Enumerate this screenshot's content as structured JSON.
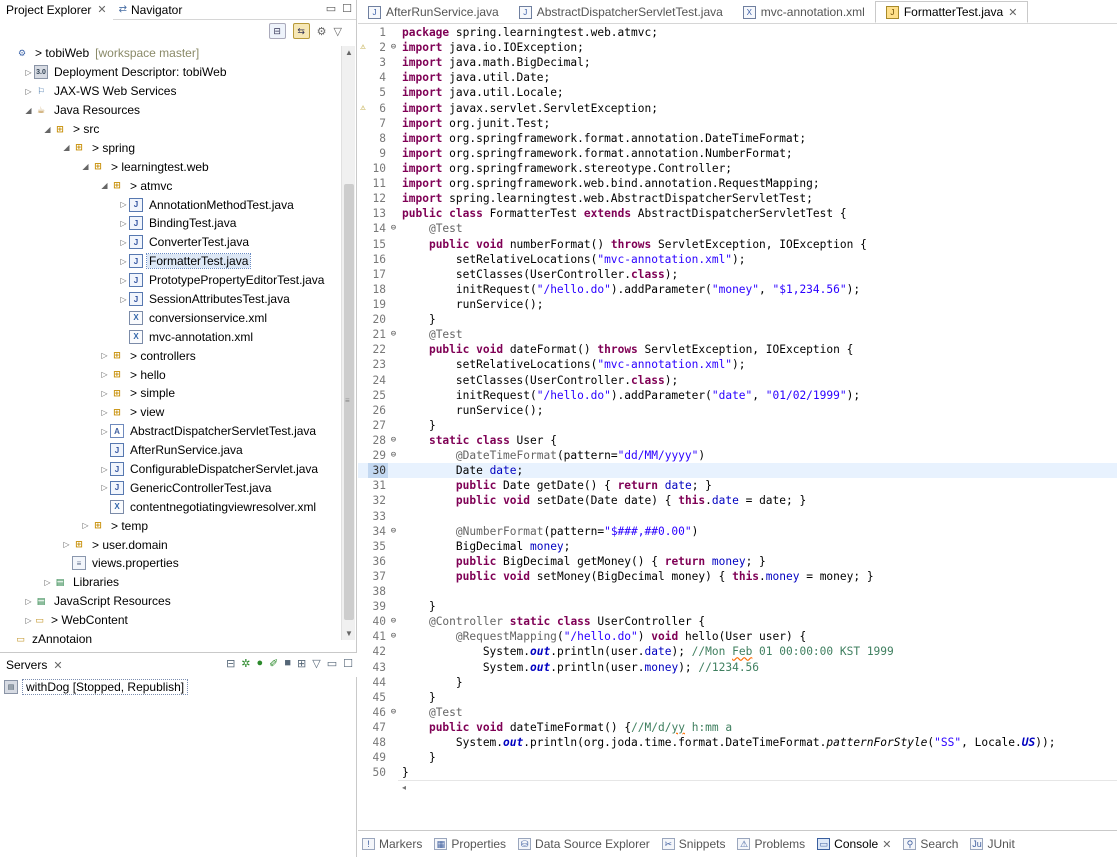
{
  "left_tabs": [
    {
      "label": "Project Explorer",
      "active": true
    },
    {
      "label": "Navigator",
      "active": false
    }
  ],
  "tree": [
    {
      "d": 0,
      "t": "",
      "ic": "proj",
      "g": "⚙",
      "label": "> tobiWeb",
      "extra": "[workspace master]"
    },
    {
      "d": 1,
      "t": "▷",
      "ic": "dd",
      "g": "3.0",
      "label": "Deployment Descriptor: tobiWeb"
    },
    {
      "d": 1,
      "t": "▷",
      "ic": "ws",
      "g": "⚐",
      "label": "JAX-WS Web Services"
    },
    {
      "d": 1,
      "t": "◢",
      "ic": "jres",
      "g": "☕",
      "label": "Java Resources"
    },
    {
      "d": 2,
      "t": "◢",
      "ic": "pkg",
      "g": "⊞",
      "label": "> src"
    },
    {
      "d": 3,
      "t": "◢",
      "ic": "pkg",
      "g": "⊞",
      "label": "> spring"
    },
    {
      "d": 4,
      "t": "◢",
      "ic": "pkg",
      "g": "⊞",
      "label": "> learningtest.web"
    },
    {
      "d": 5,
      "t": "◢",
      "ic": "pkg",
      "g": "⊞",
      "label": "> atmvc"
    },
    {
      "d": 6,
      "t": "▷",
      "ic": "java",
      "g": "J",
      "label": "AnnotationMethodTest.java"
    },
    {
      "d": 6,
      "t": "▷",
      "ic": "java",
      "g": "J",
      "label": "BindingTest.java"
    },
    {
      "d": 6,
      "t": "▷",
      "ic": "java",
      "g": "J",
      "label": "ConverterTest.java"
    },
    {
      "d": 6,
      "t": "▷",
      "ic": "java",
      "g": "J",
      "label": "FormatterTest.java",
      "sel": true
    },
    {
      "d": 6,
      "t": "▷",
      "ic": "java",
      "g": "J",
      "label": "PrototypePropertyEditorTest.java"
    },
    {
      "d": 6,
      "t": "▷",
      "ic": "java",
      "g": "J",
      "label": "SessionAttributesTest.java"
    },
    {
      "d": 6,
      "t": "",
      "ic": "xml",
      "g": "X",
      "label": "conversionservice.xml"
    },
    {
      "d": 6,
      "t": "",
      "ic": "xml",
      "g": "X",
      "label": "mvc-annotation.xml"
    },
    {
      "d": 5,
      "t": "▷",
      "ic": "pkg",
      "g": "⊞",
      "label": "> controllers"
    },
    {
      "d": 5,
      "t": "▷",
      "ic": "pkg",
      "g": "⊞",
      "label": "> hello"
    },
    {
      "d": 5,
      "t": "▷",
      "ic": "pkg",
      "g": "⊞",
      "label": "> simple"
    },
    {
      "d": 5,
      "t": "▷",
      "ic": "pkg",
      "g": "⊞",
      "label": "> view"
    },
    {
      "d": 5,
      "t": "▷",
      "ic": "ann",
      "g": "A",
      "label": "AbstractDispatcherServletTest.java"
    },
    {
      "d": 5,
      "t": "",
      "ic": "java",
      "g": "J",
      "label": "AfterRunService.java"
    },
    {
      "d": 5,
      "t": "▷",
      "ic": "java",
      "g": "J",
      "label": "ConfigurableDispatcherServlet.java"
    },
    {
      "d": 5,
      "t": "▷",
      "ic": "java",
      "g": "J",
      "label": "GenericControllerTest.java"
    },
    {
      "d": 5,
      "t": "",
      "ic": "xml",
      "g": "X",
      "label": "contentnegotiatingviewresolver.xml"
    },
    {
      "d": 4,
      "t": "▷",
      "ic": "pkg",
      "g": "⊞",
      "label": "> temp"
    },
    {
      "d": 3,
      "t": "▷",
      "ic": "pkg",
      "g": "⊞",
      "label": "> user.domain"
    },
    {
      "d": 3,
      "t": "",
      "ic": "props",
      "g": "≡",
      "label": "views.properties"
    },
    {
      "d": 2,
      "t": "▷",
      "ic": "lib",
      "g": "▤",
      "label": "Libraries"
    },
    {
      "d": 1,
      "t": "▷",
      "ic": "lib",
      "g": "▤",
      "label": "JavaScript Resources"
    },
    {
      "d": 1,
      "t": "▷",
      "ic": "fold",
      "g": "▭",
      "label": "> WebContent"
    },
    {
      "d": 0,
      "t": "",
      "ic": "fold",
      "g": "▭",
      "label": "zAnnotaion"
    }
  ],
  "servers": {
    "tab_label": "Servers",
    "row_label": "withDog",
    "row_status": "[Stopped, Republish]"
  },
  "editor_tabs": [
    {
      "label": "AfterRunService.java",
      "icon": "J",
      "active": false
    },
    {
      "label": "AbstractDispatcherServletTest.java",
      "icon": "J",
      "active": false
    },
    {
      "label": "mvc-annotation.xml",
      "icon": "X",
      "active": false
    },
    {
      "label": "FormatterTest.java",
      "icon": "J",
      "active": true
    }
  ],
  "code_lines": [
    "<span class='k'>package</span> spring.learningtest.web.atmvc;",
    "<span class='k'>import</span> java.io.IOException;",
    "<span class='k'>import</span> java.math.BigDecimal;",
    "<span class='k'>import</span> java.util.Date;",
    "<span class='k'>import</span> java.util.Locale;",
    "<span class='k'>import</span> javax.servlet.ServletException;",
    "<span class='k'>import</span> org.junit.Test;",
    "<span class='k'>import</span> org.springframework.format.annotation.DateTimeFormat;",
    "<span class='k'>import</span> org.springframework.format.annotation.NumberFormat;",
    "<span class='k'>import</span> org.springframework.stereotype.Controller;",
    "<span class='k'>import</span> org.springframework.web.bind.annotation.RequestMapping;",
    "<span class='k'>import</span> spring.learningtest.web.AbstractDispatcherServletTest;",
    "<span class='k'>public</span> <span class='k'>class</span> FormatterTest <span class='k'>extends</span> AbstractDispatcherServletTest {",
    "    <span class='a'>@Test</span>",
    "    <span class='k'>public</span> <span class='k'>void</span> numberFormat() <span class='k'>throws</span> ServletException, IOException {",
    "        setRelativeLocations(<span class='s'>\"mvc-annotation.xml\"</span>);",
    "        setClasses(UserController.<span class='k'>class</span>);",
    "        initRequest(<span class='s'>\"/hello.do\"</span>).addParameter(<span class='s'>\"money\"</span>, <span class='s'>\"$1,234.56\"</span>);",
    "        runService();",
    "    }",
    "    <span class='a'>@Test</span>",
    "    <span class='k'>public</span> <span class='k'>void</span> dateFormat() <span class='k'>throws</span> ServletException, IOException {",
    "        setRelativeLocations(<span class='s'>\"mvc-annotation.xml\"</span>);",
    "        setClasses(UserController.<span class='k'>class</span>);",
    "        initRequest(<span class='s'>\"/hello.do\"</span>).addParameter(<span class='s'>\"date\"</span>, <span class='s'>\"01/02/1999\"</span>);",
    "        runService();",
    "    }",
    "    <span class='k'>static</span> <span class='k'>class</span> User {",
    "        <span class='a'>@DateTimeFormat</span>(pattern=<span class='s'>\"dd/MM/yyyy\"</span>)",
    "        Date <span class='f'>date</span>;",
    "        <span class='k'>public</span> Date getDate() { <span class='k'>return</span> <span class='f'>date</span>; }",
    "        <span class='k'>public</span> <span class='k'>void</span> setDate(Date date) { <span class='k'>this</span>.<span class='f'>date</span> = date; }",
    "        ",
    "        <span class='a'>@NumberFormat</span>(pattern=<span class='s'>\"$###,##0.00\"</span>)",
    "        BigDecimal <span class='f'>money</span>;",
    "        <span class='k'>public</span> BigDecimal getMoney() { <span class='k'>return</span> <span class='f'>money</span>; }",
    "        <span class='k'>public</span> <span class='k'>void</span> setMoney(BigDecimal money) { <span class='k'>this</span>.<span class='f'>money</span> = money; }",
    "        ",
    "    }",
    "    <span class='a'>@Controller</span> <span class='k'>static</span> <span class='k'>class</span> UserController {",
    "        <span class='a'>@RequestMapping</span>(<span class='s'>\"/hello.do\"</span>) <span class='k'>void</span> hello(User user) {",
    "            System.<span class='sfi'>out</span>.println(user.<span class='f'>date</span>); <span class='c'>//Mon <span class='sq'>Feb</span> 01 00:00:00 KST 1999</span>",
    "            System.<span class='sfi'>out</span>.println(user.<span class='f'>money</span>); <span class='c'>//1234.56</span>",
    "        }",
    "    }",
    "    <span class='a'>@Test</span>",
    "    <span class='k'>public</span> <span class='k'>void</span> dateTimeFormat() {<span class='c'>//M/d/<span class='sq'>yy</span> h:mm a</span>",
    "        System.<span class='sfi'>out</span>.println(org.joda.time.format.DateTimeFormat.<span class='it'>patternForStyle</span>(<span class='s'>\"SS\"</span>, Locale.<span class='sfi'>US</span>));",
    "    }",
    "}"
  ],
  "bottom_tabs": [
    {
      "label": "Markers",
      "icon": "!",
      "active": false
    },
    {
      "label": "Properties",
      "icon": "▦",
      "active": false
    },
    {
      "label": "Data Source Explorer",
      "icon": "⛁",
      "active": false
    },
    {
      "label": "Snippets",
      "icon": "✂",
      "active": false
    },
    {
      "label": "Problems",
      "icon": "⚠",
      "active": false
    },
    {
      "label": "Console",
      "icon": "▭",
      "active": true
    },
    {
      "label": "Search",
      "icon": "⚲",
      "active": false
    },
    {
      "label": "JUnit",
      "icon": "Ju",
      "active": false
    }
  ]
}
